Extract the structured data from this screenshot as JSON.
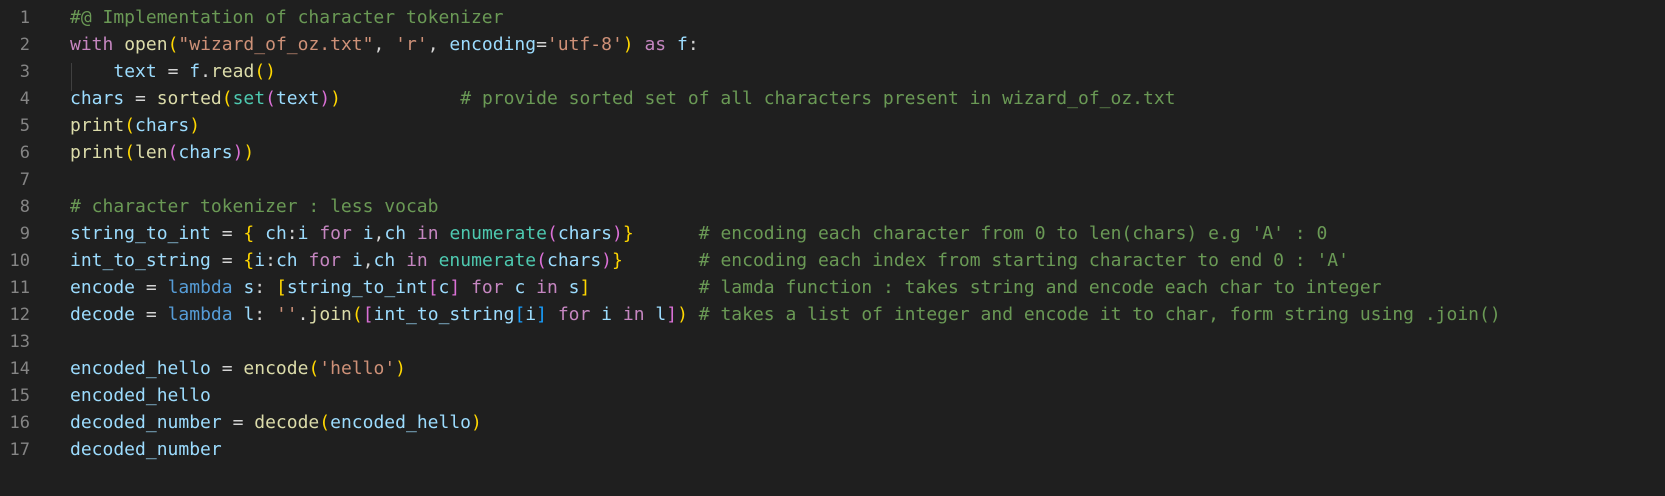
{
  "editor": {
    "top_fragment": "  ",
    "lines": [
      {
        "num": "1",
        "code": "#@ Implementation of character tokenizer"
      },
      {
        "num": "2",
        "code": "with open(\"wizard_of_oz.txt\", 'r', encoding='utf-8') as f:"
      },
      {
        "num": "3",
        "code": "    text = f.read()"
      },
      {
        "num": "4",
        "code": "chars = sorted(set(text))           # provide sorted set of all characters present in wizard_of_oz.txt"
      },
      {
        "num": "5",
        "code": "print(chars)"
      },
      {
        "num": "6",
        "code": "print(len(chars))"
      },
      {
        "num": "7",
        "code": ""
      },
      {
        "num": "8",
        "code": "# character tokenizer : less vocab"
      },
      {
        "num": "9",
        "code": "string_to_int = { ch:i for i,ch in enumerate(chars)}      # encoding each character from 0 to len(chars) e.g 'A' : 0"
      },
      {
        "num": "10",
        "code": "int_to_string = {i:ch for i,ch in enumerate(chars)}       # encoding each index from starting character to end 0 : 'A'"
      },
      {
        "num": "11",
        "code": "encode = lambda s: [string_to_int[c] for c in s]          # lamda function : takes string and encode each char to integer"
      },
      {
        "num": "12",
        "code": "decode = lambda l: ''.join([int_to_string[i] for i in l]) # takes a list of integer and encode it to char, form string using .join()"
      },
      {
        "num": "13",
        "code": ""
      },
      {
        "num": "14",
        "code": "encoded_hello = encode('hello')"
      },
      {
        "num": "15",
        "code": "encoded_hello"
      },
      {
        "num": "16",
        "code": "decoded_number = decode(encoded_hello)"
      },
      {
        "num": "17",
        "code": "decoded_number"
      }
    ]
  },
  "colors": {
    "background": "#1f1f1f",
    "comment": "#6a9955",
    "keyword": "#c586c0",
    "function": "#dcdcaa",
    "variable": "#9cdcfe",
    "string": "#ce9178",
    "builtin": "#4ec9b0",
    "line_number": "#858585"
  }
}
